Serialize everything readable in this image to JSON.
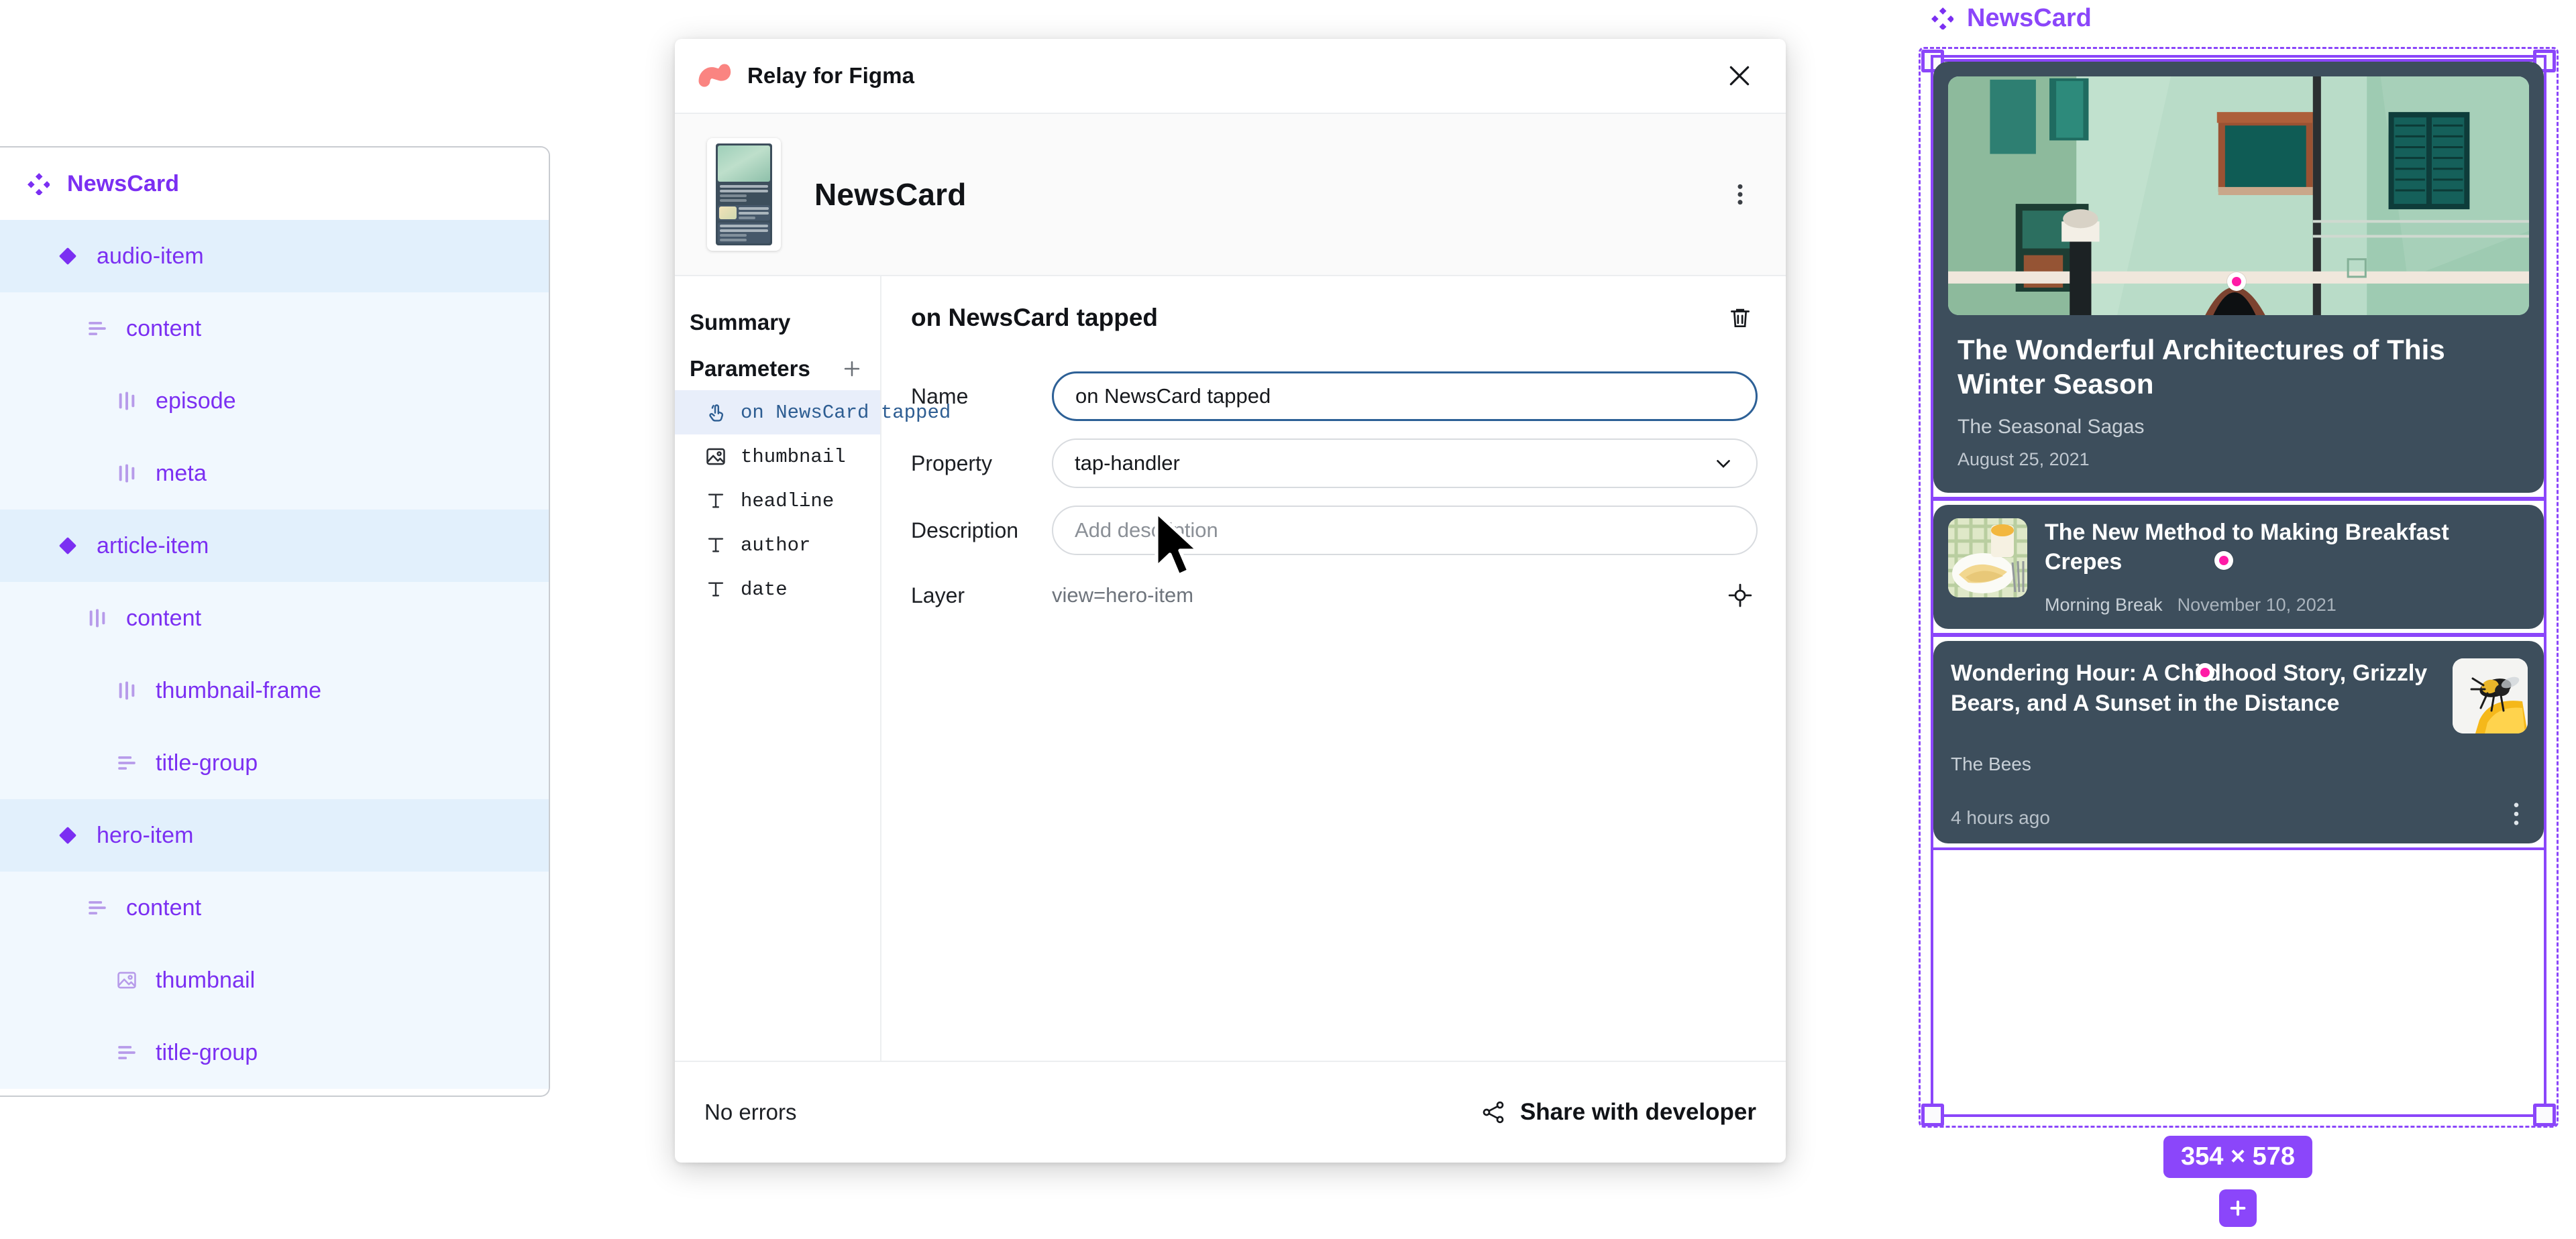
{
  "layer_tree": {
    "rows": [
      {
        "label": "NewsCard",
        "icon": "component-set-icon",
        "depth": 0,
        "kind": "root"
      },
      {
        "label": "audio-item",
        "icon": "component-icon",
        "depth": 1,
        "kind": "component"
      },
      {
        "label": "content",
        "icon": "autolayout-vertical-icon",
        "depth": 2,
        "kind": "child"
      },
      {
        "label": "episode",
        "icon": "autolayout-horizontal-icon",
        "depth": 3,
        "kind": "child"
      },
      {
        "label": "meta",
        "icon": "autolayout-horizontal-icon",
        "depth": 3,
        "kind": "child"
      },
      {
        "label": "article-item",
        "icon": "component-icon",
        "depth": 1,
        "kind": "component"
      },
      {
        "label": "content",
        "icon": "autolayout-horizontal-icon",
        "depth": 2,
        "kind": "child"
      },
      {
        "label": "thumbnail-frame",
        "icon": "autolayout-horizontal-icon",
        "depth": 3,
        "kind": "child"
      },
      {
        "label": "title-group",
        "icon": "autolayout-vertical-icon",
        "depth": 3,
        "kind": "child"
      },
      {
        "label": "hero-item",
        "icon": "component-icon",
        "depth": 1,
        "kind": "component"
      },
      {
        "label": "content",
        "icon": "autolayout-vertical-icon",
        "depth": 2,
        "kind": "child"
      },
      {
        "label": "thumbnail",
        "icon": "image-icon",
        "depth": 3,
        "kind": "child"
      },
      {
        "label": "title-group",
        "icon": "autolayout-vertical-icon",
        "depth": 3,
        "kind": "child"
      }
    ]
  },
  "dialog": {
    "titlebar": {
      "app_name": "Relay for Figma",
      "logo_icon": "relay-logo-icon",
      "close_icon": "close-icon"
    },
    "header": {
      "component_name": "NewsCard",
      "thumbnail_icon": "component-thumbnail",
      "kebab_icon": "more-vertical-icon"
    },
    "left_panel": {
      "summary_label": "Summary",
      "parameters_label": "Parameters",
      "add_icon": "plus-icon",
      "parameters": [
        {
          "label": "on NewsCard tapped",
          "icon": "tap-handler-icon",
          "selected": true
        },
        {
          "label": "thumbnail",
          "icon": "image-icon",
          "selected": false
        },
        {
          "label": "headline",
          "icon": "text-icon",
          "selected": false
        },
        {
          "label": "author",
          "icon": "text-icon",
          "selected": false
        },
        {
          "label": "date",
          "icon": "text-icon",
          "selected": false
        }
      ]
    },
    "detail": {
      "title": "on NewsCard tapped",
      "delete_icon": "trash-icon",
      "name_label": "Name",
      "name_value": "on NewsCard tapped",
      "property_label": "Property",
      "property_value": "tap-handler",
      "property_chevron_icon": "chevron-down-icon",
      "description_label": "Description",
      "description_value": "",
      "description_placeholder": "Add description",
      "layer_label": "Layer",
      "layer_value": "view=hero-item",
      "layer_target_icon": "target-icon"
    },
    "footer": {
      "status": "No errors",
      "share_label": "Share with developer",
      "share_icon": "share-icon"
    }
  },
  "cursor": {
    "icon": "mouse-pointer-icon"
  },
  "preview": {
    "component_label": "NewsCard",
    "component_icon": "component-set-icon",
    "size_badge": "354 × 578",
    "plus_icon": "plus-icon",
    "accent_color": "#8b46fa",
    "card_bg_color": "#3d4e5c",
    "marker_color": "#ff1ba6",
    "cards": [
      {
        "type": "hero",
        "headline": "The Wonderful Architectures of This Winter Season",
        "author": "The Seasonal Sagas",
        "date": "August 25, 2021",
        "image": "green-building-facade"
      },
      {
        "type": "article",
        "headline": "The New Method to Making Breakfast Crepes",
        "author": "Morning Break",
        "date": "November 10, 2021",
        "image": "crepes-breakfast-plate"
      },
      {
        "type": "audio",
        "headline": "Wondering Hour: A Childhood Story, Grizzly Bears, and A Sunset in the Distance",
        "author": "The Bees",
        "date": "4 hours ago",
        "image": "bee-on-yellow-cup",
        "kebab_icon": "more-vertical-icon"
      }
    ]
  }
}
